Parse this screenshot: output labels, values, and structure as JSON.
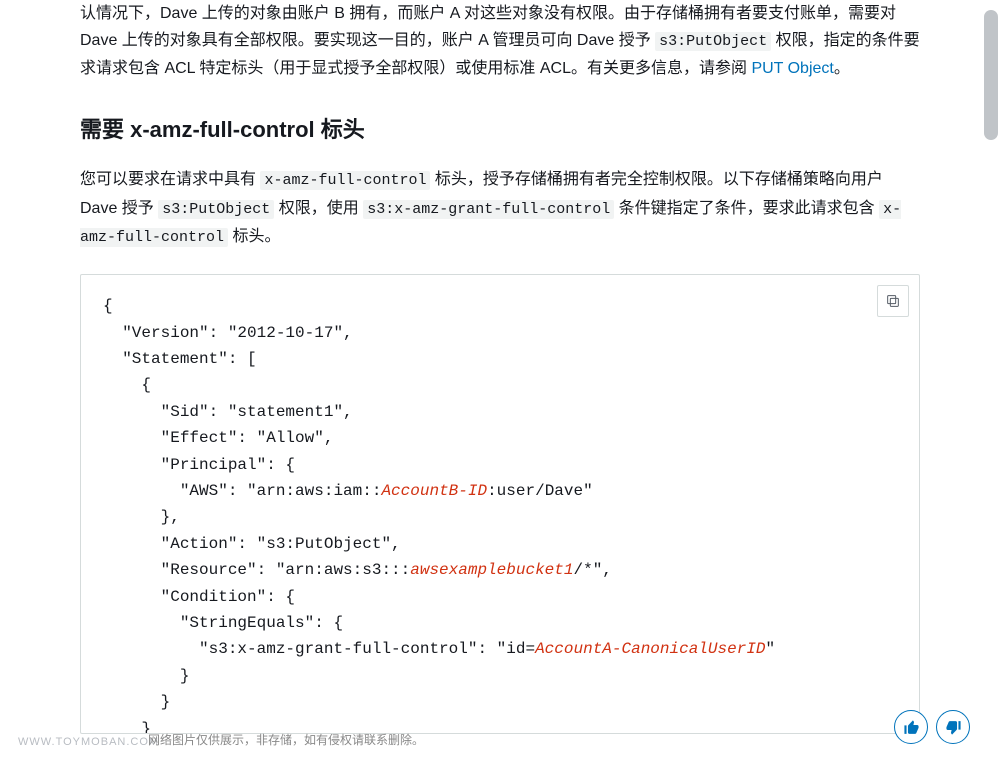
{
  "para1": {
    "seg1": "认情况下，Dave 上传的对象由账户 B 拥有，而账户 A 对这些对象没有权限。由于存储桶拥有者要支付账单，需要对 Dave 上传的对象具有全部权限。要实现这一目的，账户 A 管理员可向 Dave 授予 ",
    "code1": "s3:PutObject",
    "seg2": " 权限，指定的条件要求请求包含 ACL 特定标头（用于显式授予全部权限）或使用标准 ACL。有关更多信息，请参阅 ",
    "link": "PUT Object",
    "seg3": "。"
  },
  "heading": "需要 x-amz-full-control 标头",
  "para2": {
    "seg1": "您可以要求在请求中具有 ",
    "code1": "x-amz-full-control",
    "seg2": " 标头，授予存储桶拥有者完全控制权限。以下存储桶策略向用户 Dave 授予 ",
    "code2": "s3:PutObject",
    "seg3": " 权限，使用 ",
    "code3": "s3:x-amz-grant-full-control",
    "seg4": " 条件键指定了条件，要求此请求包含 ",
    "code4": "x-amz-full-control",
    "seg5": " 标头。"
  },
  "code": {
    "l1": "{",
    "l2": "  \"Version\": \"2012-10-17\",",
    "l3": "  \"Statement\": [",
    "l4": "    {",
    "l5": "      \"Sid\": \"statement1\",",
    "l6": "      \"Effect\": \"Allow\",",
    "l7": "      \"Principal\": {",
    "l8a": "        \"AWS\": \"arn:aws:iam::",
    "l8r": "AccountB-ID",
    "l8b": ":user/Dave\"",
    "l9": "      },",
    "l10": "      \"Action\": \"s3:PutObject\",",
    "l11a": "      \"Resource\": \"arn:aws:s3:::",
    "l11r": "awsexamplebucket1",
    "l11b": "/*\",",
    "l12": "      \"Condition\": {",
    "l13": "        \"StringEquals\": {",
    "l14a": "          \"s3:x-amz-grant-full-control\": \"id=",
    "l14r": "AccountA-CanonicalUserID",
    "l14b": "\"",
    "l15": "        }",
    "l16": "      }",
    "l17": "    }"
  },
  "watermark": "WWW.TOYMOBAN.COM",
  "watermark_note": "网络图片仅供展示，非存储，如有侵权请联系删除。"
}
